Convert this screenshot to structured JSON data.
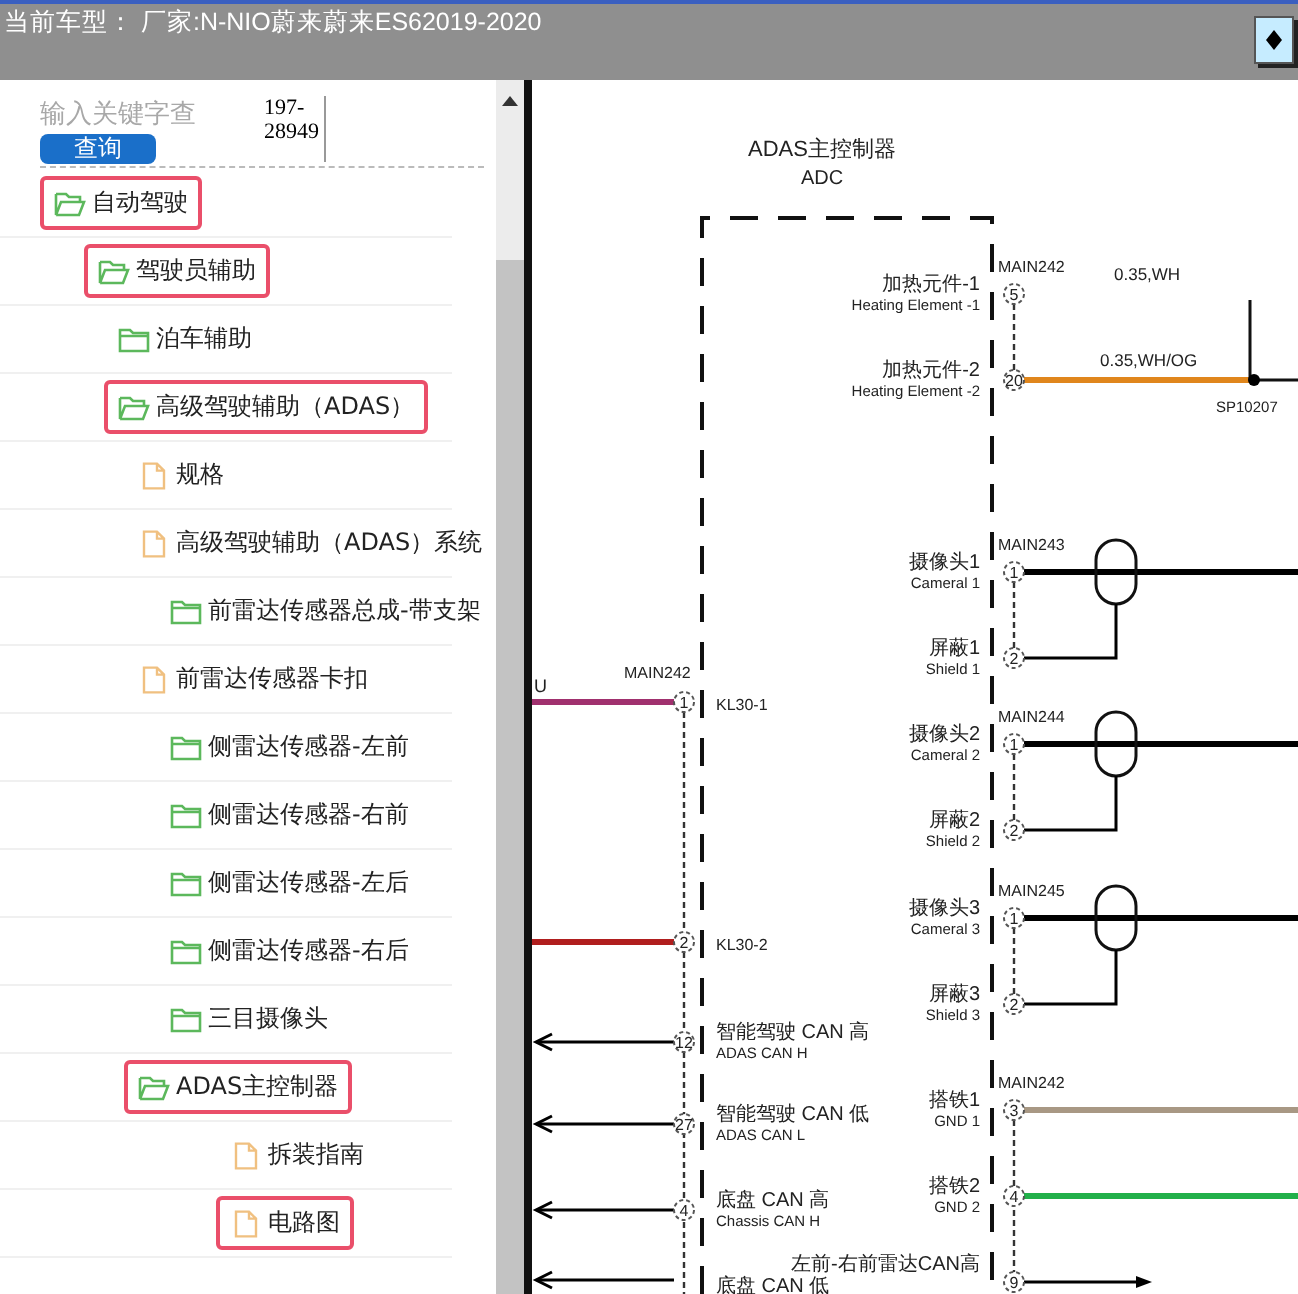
{
  "header": {
    "label": "当前车型：",
    "value": "厂家:N-NIO蔚来蔚来ES62019-2020"
  },
  "search": {
    "placeholder": "输入关键字查",
    "button": "查询",
    "code": [
      "197-",
      "28949"
    ]
  },
  "tree": [
    {
      "label": "自动驾驶",
      "kind": "folder",
      "expanded": true,
      "highlighted": true,
      "children": [
        {
          "label": "驾驶员辅助",
          "kind": "folder",
          "expanded": true,
          "highlighted": true,
          "children": [
            {
              "label": "泊车辅助",
              "kind": "folder",
              "expanded": false,
              "highlighted": false
            },
            {
              "label": "高级驾驶辅助（ADAS）",
              "kind": "folder",
              "expanded": true,
              "highlighted": true,
              "children": [
                {
                  "label": "规格",
                  "kind": "file",
                  "highlighted": false
                },
                {
                  "label": "高级驾驶辅助（ADAS）系统",
                  "kind": "file",
                  "highlighted": false
                },
                {
                  "label": "前雷达传感器总成-带支架",
                  "kind": "folder",
                  "expanded": false,
                  "highlighted": false
                },
                {
                  "label": "前雷达传感器卡扣",
                  "kind": "file",
                  "highlighted": false
                },
                {
                  "label": "侧雷达传感器-左前",
                  "kind": "folder",
                  "expanded": false,
                  "highlighted": false
                },
                {
                  "label": "侧雷达传感器-右前",
                  "kind": "folder",
                  "expanded": false,
                  "highlighted": false
                },
                {
                  "label": "侧雷达传感器-左后",
                  "kind": "folder",
                  "expanded": false,
                  "highlighted": false
                },
                {
                  "label": "侧雷达传感器-右后",
                  "kind": "folder",
                  "expanded": false,
                  "highlighted": false
                },
                {
                  "label": "三目摄像头",
                  "kind": "folder",
                  "expanded": false,
                  "highlighted": false
                },
                {
                  "label": "ADAS主控制器",
                  "kind": "folder",
                  "expanded": true,
                  "highlighted": true,
                  "children": [
                    {
                      "label": "拆装指南",
                      "kind": "file",
                      "highlighted": false
                    },
                    {
                      "label": "电路图",
                      "kind": "file",
                      "highlighted": true
                    }
                  ]
                }
              ]
            }
          ]
        }
      ]
    }
  ],
  "diagram": {
    "title": "ADAS主控制器",
    "subtitle": "ADC",
    "connectors": [
      {
        "kind": "right-column",
        "name": "MAIN242",
        "pins": [
          {
            "number": "5",
            "label": "加热元件-1",
            "label_en": "Heating Element -1",
            "wire": {
              "kind": "none",
              "label": "0.35,WH"
            }
          },
          {
            "number": "20",
            "label": "加热元件-2",
            "label_en": "Heating Element -2",
            "wire": {
              "kind": "splice",
              "color": "#e0861c",
              "label": "0.35,WH/OG",
              "splice": "SP10207"
            }
          }
        ]
      },
      {
        "kind": "right-column",
        "name": "MAIN243",
        "pins": [
          {
            "number": "1",
            "label": "摄像头1",
            "label_en": "Cameral 1",
            "wire": {
              "kind": "shielded",
              "color": "#000000"
            }
          },
          {
            "number": "2",
            "label": "屏蔽1",
            "label_en": "Shield 1",
            "wire": {
              "kind": "drain",
              "color": "#000000"
            }
          }
        ]
      },
      {
        "kind": "right-column",
        "name": "MAIN244",
        "pins": [
          {
            "number": "1",
            "label": "摄像头2",
            "label_en": "Cameral 2",
            "wire": {
              "kind": "shielded",
              "color": "#000000"
            }
          },
          {
            "number": "2",
            "label": "屏蔽2",
            "label_en": "Shield 2",
            "wire": {
              "kind": "drain",
              "color": "#000000"
            }
          }
        ]
      },
      {
        "kind": "right-column",
        "name": "MAIN245",
        "pins": [
          {
            "number": "1",
            "label": "摄像头3",
            "label_en": "Cameral 3",
            "wire": {
              "kind": "shielded",
              "color": "#000000"
            }
          },
          {
            "number": "2",
            "label": "屏蔽3",
            "label_en": "Shield 3",
            "wire": {
              "kind": "drain",
              "color": "#000000"
            }
          }
        ]
      },
      {
        "kind": "right-column",
        "name": "MAIN242",
        "pins": [
          {
            "number": "3",
            "label": "搭铁1",
            "label_en": "GND 1",
            "wire": {
              "kind": "plain",
              "color": "#a89884"
            }
          },
          {
            "number": "4",
            "label": "搭铁2",
            "label_en": "GND 2",
            "wire": {
              "kind": "plain",
              "color": "#22b04a"
            }
          },
          {
            "number": "9",
            "label": "左前-右前雷达CAN高",
            "wire": {
              "kind": "arrow",
              "color": "#000000"
            }
          }
        ]
      },
      {
        "kind": "left-column",
        "name": "MAIN242",
        "pins": [
          {
            "number": "1",
            "label": "KL30-1",
            "wire": {
              "kind": "plain",
              "color": "#a0306e",
              "label": "U"
            }
          },
          {
            "number": "2",
            "label": "KL30-2",
            "wire": {
              "kind": "plain",
              "color": "#b01e1e"
            }
          },
          {
            "number": "12",
            "label": "智能驾驶 CAN 高",
            "label_en": "ADAS CAN H",
            "wire": {
              "kind": "arrow",
              "color": "#000000"
            }
          },
          {
            "number": "27",
            "label": "智能驾驶 CAN 低",
            "label_en": "ADAS CAN L",
            "wire": {
              "kind": "arrow",
              "color": "#000000"
            }
          },
          {
            "number": "4",
            "label": "底盘 CAN 高",
            "label_en": "Chassis CAN H",
            "wire": {
              "kind": "arrow",
              "color": "#000000"
            }
          },
          {
            "label": "底盘 CAN 低",
            "wire": {
              "kind": "arrow",
              "color": "#000000"
            }
          }
        ]
      }
    ]
  }
}
